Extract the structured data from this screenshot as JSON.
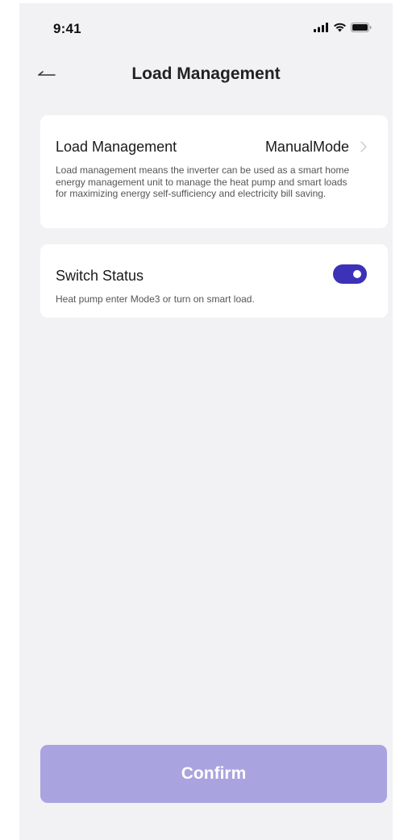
{
  "status_bar": {
    "time": "9:41",
    "icons": [
      "signal-icon",
      "wifi-icon",
      "battery-icon"
    ]
  },
  "header": {
    "back_icon": "back-arrow-icon",
    "title": "Load Management"
  },
  "load_management_card": {
    "title": "Load Management",
    "value": "ManualMode",
    "chevron_icon": "chevron-right-icon",
    "description": "Load management means the inverter can be used as a smart home energy management unit to manage the heat pump and smart loads for maximizing energy self-sufficiency and electricity bill saving."
  },
  "switch_status_card": {
    "title": "Switch Status",
    "description": "Heat pump enter Mode3 or turn on smart load.",
    "toggle_on": true
  },
  "confirm_button": {
    "label": "Confirm",
    "disabled": true
  },
  "colors": {
    "background": "#f2f2f4",
    "card": "#ffffff",
    "accent": "#3b32b8",
    "button_disabled": "#a9a4df"
  }
}
